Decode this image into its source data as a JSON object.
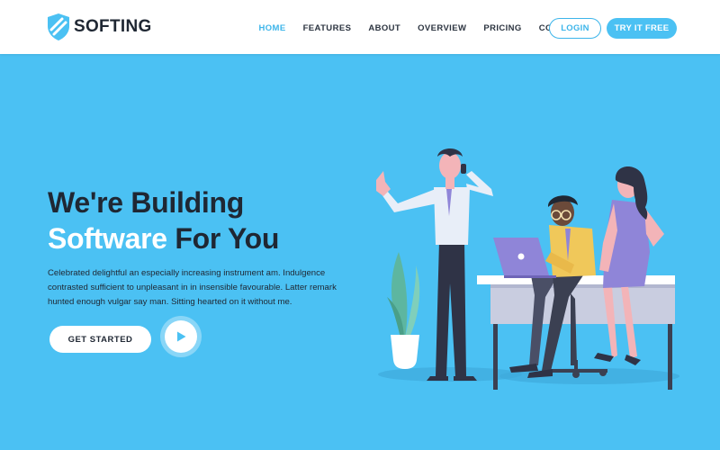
{
  "brand": {
    "name": "SOFTING",
    "logo_icon": "shield-icon"
  },
  "nav": {
    "items": [
      {
        "label": "HOME",
        "active": true
      },
      {
        "label": "FEATURES",
        "active": false
      },
      {
        "label": "ABOUT",
        "active": false
      },
      {
        "label": "OVERVIEW",
        "active": false
      },
      {
        "label": "PRICING",
        "active": false
      },
      {
        "label": "CONTACT",
        "active": false
      }
    ],
    "login_label": "LOGIN",
    "try_label": "TRY IT FREE"
  },
  "hero": {
    "title_line1": "We're Building",
    "title_highlight": "Software",
    "title_rest": " For You",
    "description": "Celebrated delightful an especially increasing instrument am. Indulgence contrasted sufficient to unpleasant in in insensible favourable. Latter remark hunted enough vulgar say man. Sitting hearted on it without me.",
    "cta_label": "GET STARTED",
    "play_icon": "play-icon"
  },
  "colors": {
    "accent": "#4bc1f3",
    "accent_dark": "#3db5ea",
    "text_dark": "#1f2733",
    "white": "#ffffff"
  }
}
